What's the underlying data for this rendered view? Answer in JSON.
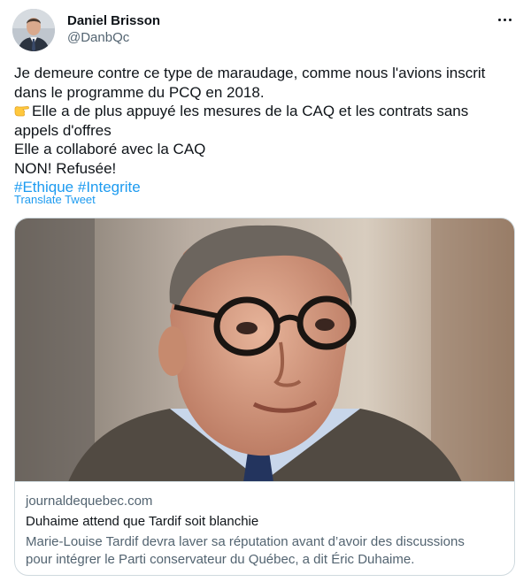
{
  "author": {
    "name": "Daniel Brisson",
    "handle": "@DanbQc"
  },
  "tweet": {
    "lines": [
      "Je demeure contre ce type de maraudage, comme nous l'avions inscrit",
      "dans le programme du PCQ en 2018.",
      "Elle a de plus appuyé les mesures de la CAQ et les contrats sans",
      "appels d'offres",
      "Elle a collaboré avec la CAQ",
      "NON! Refusée!"
    ],
    "hashtags": [
      "#Ethique",
      "#Integrite"
    ],
    "translate_label": "Translate Tweet"
  },
  "link_card": {
    "domain": "journaldequebec.com",
    "title": "Duhaime attend que Tardif soit blanchie",
    "description_lines": [
      "Marie-Louise Tardif devra laver sa réputation avant d’avoir des discussions",
      "pour intégrer le Parti conservateur du Québec, a dit Éric Duhaime."
    ]
  },
  "icons": {
    "more": "more-horizontal-icon",
    "pointing": "backhand-index-pointing-right-emoji"
  },
  "colors": {
    "link": "#1d9bf0",
    "text": "#0f1419",
    "secondary": "#536471",
    "border": "#cfd9de"
  }
}
